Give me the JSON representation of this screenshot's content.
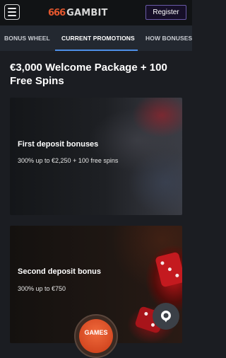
{
  "header": {
    "logo_mark": "666",
    "logo_text": "GAMBIT",
    "register_label": "Register"
  },
  "tabs": [
    {
      "label": "BONUS WHEEL",
      "active": false
    },
    {
      "label": "CURRENT PROMOTIONS",
      "active": true
    },
    {
      "label": "HOW BONUSES",
      "active": false
    }
  ],
  "page_title": "€3,000 Welcome Package + 100 Free Spins",
  "cards": [
    {
      "title": "First deposit bonuses",
      "subtitle": "300% up to €2,250 + 100 free spins"
    },
    {
      "title": "Second deposit bonus",
      "subtitle": "300% up to €750"
    }
  ],
  "games_button": {
    "label": "GAMES"
  },
  "icons": {
    "menu": "hamburger-menu-icon",
    "chat": "chat-bubble-icon"
  },
  "colors": {
    "accent": "#4e8fe6",
    "brand": "#e4572e",
    "register_border": "#6a5aa8"
  }
}
